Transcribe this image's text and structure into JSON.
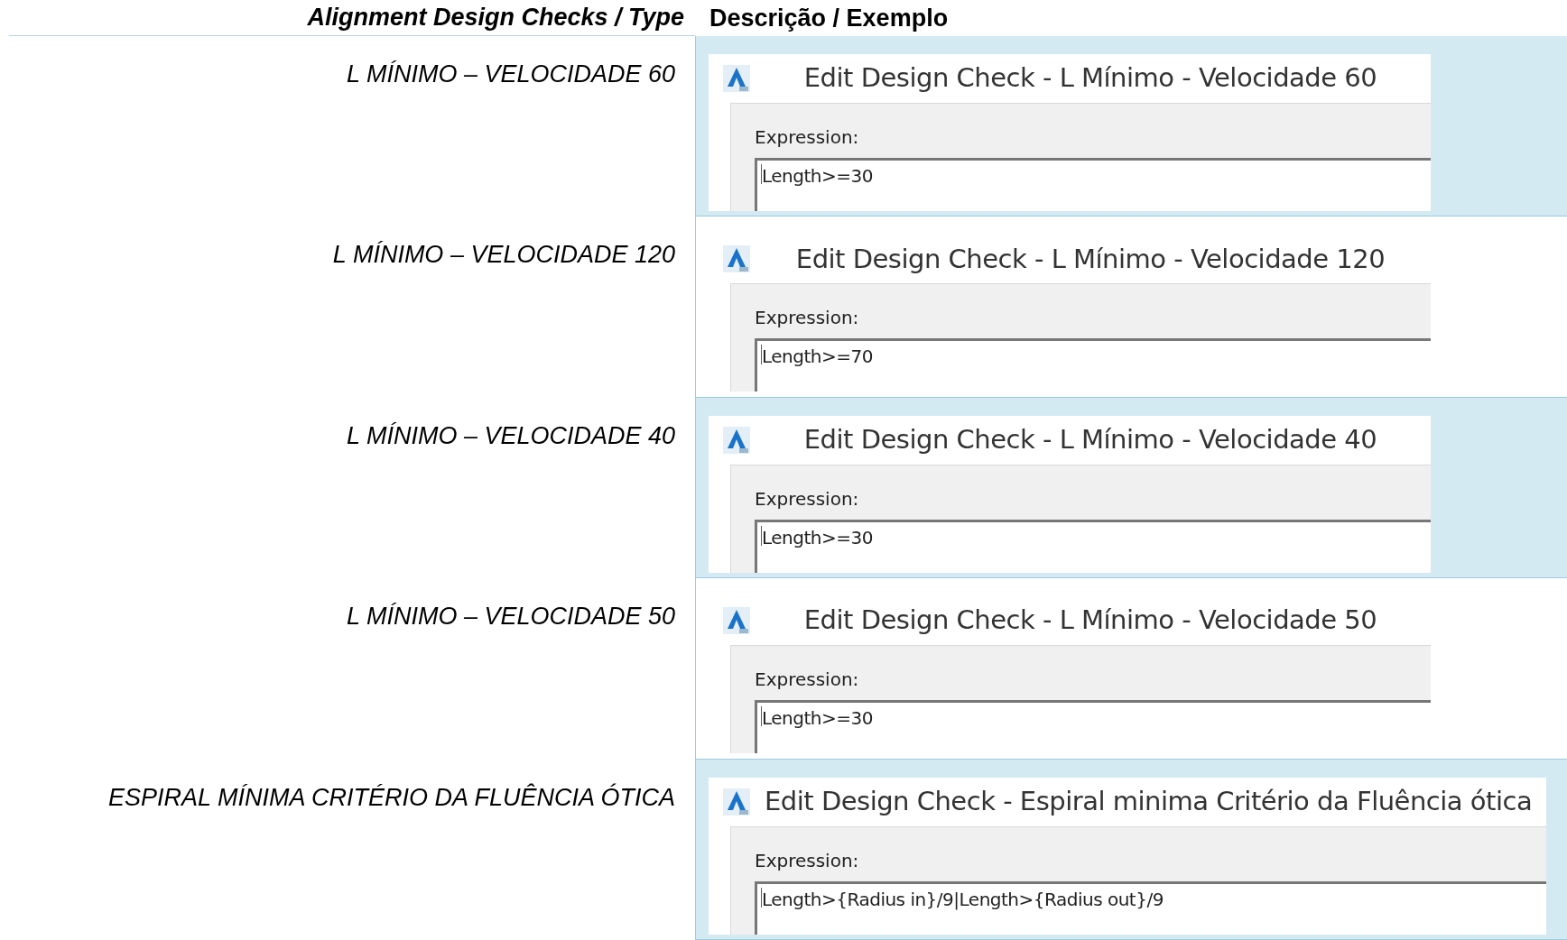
{
  "header": {
    "type_column": "Alignment Design Checks / Type",
    "description_column": "Descrição / Exemplo"
  },
  "rows": [
    {
      "type": "L MÍNIMO – VELOCIDADE 60",
      "shaded": true,
      "dialog": {
        "title": "Edit Design Check - L Mínimo - Velocidade 60",
        "label": "Expression:",
        "value": "Length>=30"
      }
    },
    {
      "type": "L MÍNIMO – VELOCIDADE 120",
      "shaded": false,
      "dialog": {
        "title": "Edit Design Check - L Mínimo - Velocidade 120",
        "label": "Expression:",
        "value": "Length>=70"
      }
    },
    {
      "type": "L MÍNIMO – VELOCIDADE 40",
      "shaded": true,
      "dialog": {
        "title": "Edit Design Check - L Mínimo - Velocidade 40",
        "label": "Expression:",
        "value": "Length>=30"
      }
    },
    {
      "type": "L MÍNIMO – VELOCIDADE 50",
      "shaded": false,
      "dialog": {
        "title": "Edit Design Check - L Mínimo - Velocidade 50",
        "label": "Expression:",
        "value": "Length>=30"
      }
    },
    {
      "type": "ESPIRAL MÍNIMA CRITÉRIO DA FLUÊNCIA ÓTICA",
      "shaded": true,
      "dialog": {
        "title": "Edit Design Check - Espiral minima Critério da Fluência ótica",
        "label": "Expression:",
        "value": "Length>{Radius in}/9|Length>{Radius out}/9"
      }
    }
  ]
}
